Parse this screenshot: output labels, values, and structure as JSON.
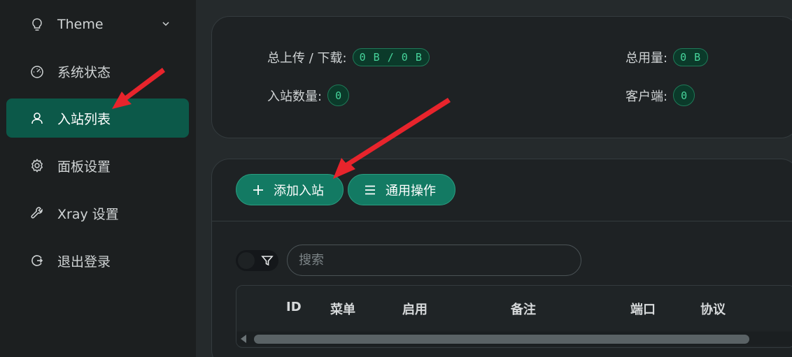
{
  "sidebar": {
    "items": [
      {
        "label": "Theme",
        "icon": "bulb-icon"
      },
      {
        "label": "系统状态",
        "icon": "dashboard-icon"
      },
      {
        "label": "入站列表",
        "icon": "user-icon",
        "active": true
      },
      {
        "label": "面板设置",
        "icon": "gear-icon"
      },
      {
        "label": "Xray 设置",
        "icon": "tool-icon"
      },
      {
        "label": "退出登录",
        "icon": "logout-icon"
      }
    ]
  },
  "stats": {
    "upload_download_label": "总上传 / 下载:",
    "upload_download_value": "0 B / 0 B",
    "total_usage_label": "总用量:",
    "total_usage_value": "0 B",
    "inbound_count_label": "入站数量:",
    "inbound_count_value": "0",
    "clients_label": "客户端:",
    "clients_value": "0"
  },
  "toolbar": {
    "add_inbound_label": "添加入站",
    "general_actions_label": "通用操作"
  },
  "search": {
    "placeholder": "搜索"
  },
  "table": {
    "columns": [
      "ID",
      "菜单",
      "启用",
      "备注",
      "端口",
      "协议"
    ]
  },
  "colors": {
    "accent": "#0c5949",
    "button": "#137a63",
    "pill_text": "#46d39a",
    "annotation_arrow": "#e8242c"
  }
}
